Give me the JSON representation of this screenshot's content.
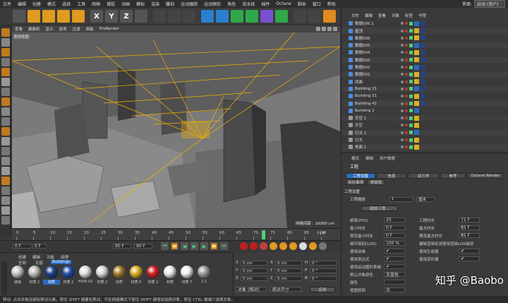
{
  "menubar": {
    "items": [
      "文件",
      "编辑",
      "创建",
      "模式",
      "选择",
      "工具",
      "网格",
      "捕捉",
      "动画",
      "模拟",
      "渲染",
      "雕刻",
      "运动跟踪",
      "运动图形",
      "角色",
      "流水线",
      "插件",
      "Octane",
      "脚本",
      "窗口",
      "帮助"
    ],
    "layout_label": "界面:",
    "layout_value": "启动 (用户)"
  },
  "toolbar": {
    "icons": [
      "cursor-icon",
      "move-icon",
      "scale-icon",
      "rotate-icon",
      "add-icon",
      "x-axis-icon",
      "y-axis-icon",
      "z-axis-icon",
      "coord-icon",
      "render-view-icon",
      "render-icon",
      "render-settings-icon",
      "cube-icon",
      "pen-icon",
      "subdivide-icon",
      "cloner-icon",
      "deformer-icon",
      "environment-icon",
      "camera-icon",
      "light-icon",
      "octane-icon"
    ],
    "axis": [
      "X",
      "Y",
      "Z"
    ],
    "colors": {
      "accent": "#f0a030"
    }
  },
  "viewport": {
    "menu": [
      "查看",
      "摄像机",
      "显示",
      "选项",
      "过滤",
      "面板",
      "ProRender"
    ],
    "label": "透视视图",
    "grid": "网格间距 : 10000 cm"
  },
  "timeline": {
    "ticks": [
      "0",
      "5",
      "10",
      "15",
      "20",
      "25",
      "30",
      "35",
      "40",
      "45",
      "50",
      "55",
      "60",
      "65",
      "70",
      "75",
      "80",
      "85",
      "90"
    ],
    "frame": "71 F"
  },
  "playbar": {
    "start": "0 F",
    "cur": "0 F",
    "end": "90 F",
    "end2": "90 F"
  },
  "materials": {
    "menu": [
      "创建",
      "编辑",
      "功能",
      "纹理"
    ],
    "tabs": [
      "全部",
      "无层",
      "Buildings"
    ],
    "items": [
      {
        "name": "玻璃",
        "color": "#c8c8c8"
      },
      {
        "name": "材质.1",
        "color": "#bdbdbd"
      },
      {
        "name": "材质",
        "color": "#1c3f8c"
      },
      {
        "name": "材质.2",
        "color": "#1d4ba8"
      },
      {
        "name": "HDRI.02",
        "color": "#e0e0e0"
      },
      {
        "name": "材质.2",
        "color": "#d8d8d8"
      },
      {
        "name": "材质",
        "color": "#a07a2c"
      },
      {
        "name": "材质.5",
        "color": "#d8b020"
      },
      {
        "name": "材质.2",
        "color": "#d02020"
      },
      {
        "name": "材质",
        "color": "#ececec"
      },
      {
        "name": "材质.7",
        "color": "#f0f0f0"
      },
      {
        "name": "2.2",
        "color": "#9a9a9a"
      }
    ]
  },
  "coords": {
    "rows": [
      [
        "X",
        "0 cm",
        "X",
        "0 cm",
        "H",
        "0 °"
      ],
      [
        "Y",
        "0 cm",
        "Y",
        "0 cm",
        "P",
        "0 °"
      ],
      [
        "Z",
        "0 cm",
        "Z",
        "0 cm",
        "B",
        "0 °"
      ]
    ],
    "mode": "对象 (相对)",
    "size": "绝对尺寸",
    "apply": "应用"
  },
  "objects": {
    "menu": [
      "文件",
      "编辑",
      "查看",
      "对象",
      "标签",
      "书签"
    ],
    "rows": [
      "数据006.1",
      "屋顶",
      "数据006",
      "数据005",
      "数据004",
      "数据003",
      "数据002",
      "数据001",
      "西面",
      "Building 21",
      "Building 31",
      "Building 42",
      "Building 2",
      "天空.1",
      "天空",
      "灯光.1",
      "灯光",
      "地面.1"
    ]
  },
  "attributes": {
    "menu": [
      "模式",
      "编辑",
      "用户数据"
    ],
    "title": "工程",
    "tabs": [
      "工程设置",
      "信息",
      "动力学",
      "参考",
      "Octane Render",
      "待办事项",
      "帧插值"
    ],
    "section": "工程设置",
    "rows": [
      {
        "label": "工程缩放",
        "value": "1",
        "unit": "厘米"
      },
      {
        "label": "缩放工程...",
        "value": "",
        "unit": ""
      }
    ],
    "left": [
      {
        "label": "帧率(FPS)",
        "value": "25"
      },
      {
        "label": "最小时长",
        "value": "0 F"
      },
      {
        "label": "预览最小时长",
        "value": "0 F"
      },
      {
        "label": "细节级别(LOD)",
        "value": "100 %"
      },
      {
        "label": "使用动画",
        "value": "✔"
      },
      {
        "label": "使用表达式",
        "value": "✔"
      },
      {
        "label": "使用运动图形系统",
        "value": "✔"
      },
      {
        "label": "默认对象颜色",
        "value": "灰蓝色"
      },
      {
        "label": "颜色",
        "value": ""
      },
      {
        "label": "视图修剪",
        "value": "中"
      }
    ],
    "right": [
      {
        "label": "工程时长",
        "value": "71 F"
      },
      {
        "label": "最大时长",
        "value": "85 F"
      },
      {
        "label": "预览最大时长",
        "value": "85 F"
      },
      {
        "label": "编辑渲染检测使用渲染LOD级别",
        "value": ""
      },
      {
        "label": "使用生成器",
        "value": "✔"
      },
      {
        "label": "使用变形器",
        "value": "✔"
      }
    ]
  },
  "status": "移动: 点击并拖动鼠标移动元素。按住 SHIFT 键量化移动；可在网格模式下按住 SHIFT 键增加选择对象；按住 CTRL 键减少选择对象。",
  "watermark": "知乎 @Baobo"
}
